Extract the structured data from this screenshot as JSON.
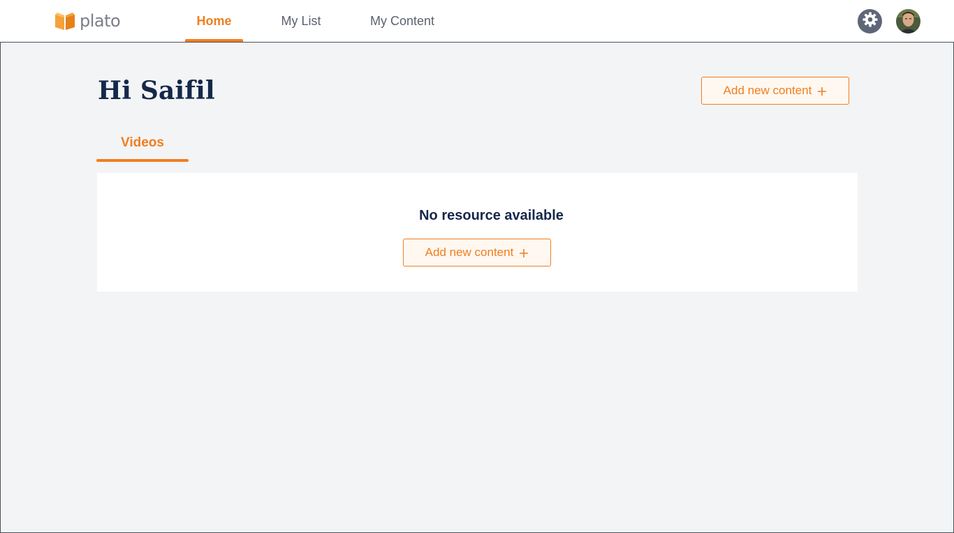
{
  "app": {
    "logo_text": "plato",
    "logo_icon": "open-book-icon"
  },
  "nav": {
    "tabs": [
      {
        "label": "Home",
        "active": true
      },
      {
        "label": "My List",
        "active": false
      },
      {
        "label": "My Content",
        "active": false
      }
    ]
  },
  "header_actions": {
    "settings_icon": "gear-icon",
    "avatar_icon": "user-avatar"
  },
  "main": {
    "greeting": "Hi Saifil",
    "add_content_label": "Add new content",
    "tabs": [
      {
        "label": "Videos",
        "active": true
      }
    ],
    "empty_state": {
      "title": "No resource available",
      "button_label": "Add new content"
    }
  },
  "colors": {
    "accent": "#f07e1e",
    "heading": "#15284a",
    "background": "#f3f4f6",
    "nav_text": "#5b6270"
  }
}
